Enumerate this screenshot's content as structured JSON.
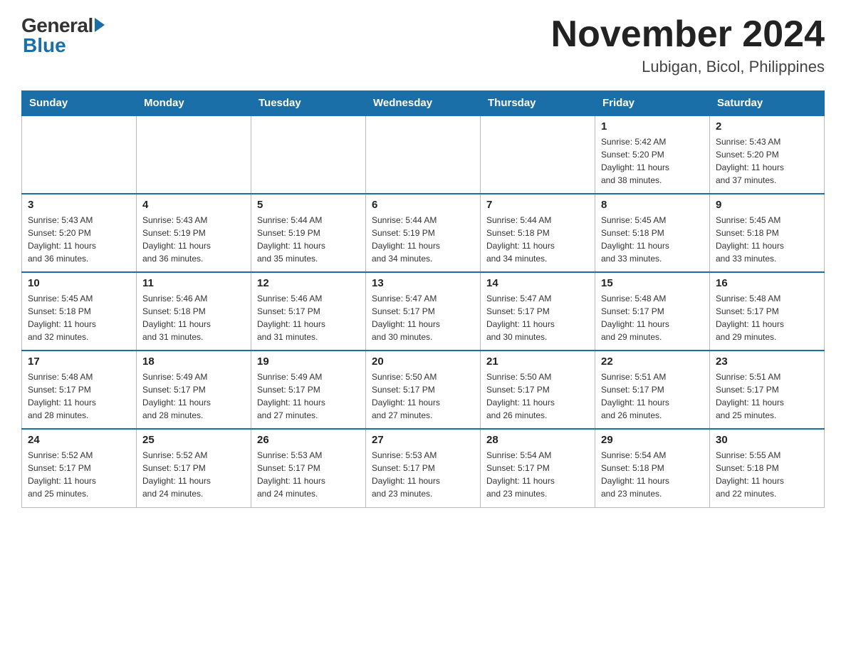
{
  "header": {
    "logo_general": "General",
    "logo_blue": "Blue",
    "month_year": "November 2024",
    "location": "Lubigan, Bicol, Philippines"
  },
  "weekdays": [
    "Sunday",
    "Monday",
    "Tuesday",
    "Wednesday",
    "Thursday",
    "Friday",
    "Saturday"
  ],
  "weeks": [
    [
      {
        "day": "",
        "info": ""
      },
      {
        "day": "",
        "info": ""
      },
      {
        "day": "",
        "info": ""
      },
      {
        "day": "",
        "info": ""
      },
      {
        "day": "",
        "info": ""
      },
      {
        "day": "1",
        "info": "Sunrise: 5:42 AM\nSunset: 5:20 PM\nDaylight: 11 hours\nand 38 minutes."
      },
      {
        "day": "2",
        "info": "Sunrise: 5:43 AM\nSunset: 5:20 PM\nDaylight: 11 hours\nand 37 minutes."
      }
    ],
    [
      {
        "day": "3",
        "info": "Sunrise: 5:43 AM\nSunset: 5:20 PM\nDaylight: 11 hours\nand 36 minutes."
      },
      {
        "day": "4",
        "info": "Sunrise: 5:43 AM\nSunset: 5:19 PM\nDaylight: 11 hours\nand 36 minutes."
      },
      {
        "day": "5",
        "info": "Sunrise: 5:44 AM\nSunset: 5:19 PM\nDaylight: 11 hours\nand 35 minutes."
      },
      {
        "day": "6",
        "info": "Sunrise: 5:44 AM\nSunset: 5:19 PM\nDaylight: 11 hours\nand 34 minutes."
      },
      {
        "day": "7",
        "info": "Sunrise: 5:44 AM\nSunset: 5:18 PM\nDaylight: 11 hours\nand 34 minutes."
      },
      {
        "day": "8",
        "info": "Sunrise: 5:45 AM\nSunset: 5:18 PM\nDaylight: 11 hours\nand 33 minutes."
      },
      {
        "day": "9",
        "info": "Sunrise: 5:45 AM\nSunset: 5:18 PM\nDaylight: 11 hours\nand 33 minutes."
      }
    ],
    [
      {
        "day": "10",
        "info": "Sunrise: 5:45 AM\nSunset: 5:18 PM\nDaylight: 11 hours\nand 32 minutes."
      },
      {
        "day": "11",
        "info": "Sunrise: 5:46 AM\nSunset: 5:18 PM\nDaylight: 11 hours\nand 31 minutes."
      },
      {
        "day": "12",
        "info": "Sunrise: 5:46 AM\nSunset: 5:17 PM\nDaylight: 11 hours\nand 31 minutes."
      },
      {
        "day": "13",
        "info": "Sunrise: 5:47 AM\nSunset: 5:17 PM\nDaylight: 11 hours\nand 30 minutes."
      },
      {
        "day": "14",
        "info": "Sunrise: 5:47 AM\nSunset: 5:17 PM\nDaylight: 11 hours\nand 30 minutes."
      },
      {
        "day": "15",
        "info": "Sunrise: 5:48 AM\nSunset: 5:17 PM\nDaylight: 11 hours\nand 29 minutes."
      },
      {
        "day": "16",
        "info": "Sunrise: 5:48 AM\nSunset: 5:17 PM\nDaylight: 11 hours\nand 29 minutes."
      }
    ],
    [
      {
        "day": "17",
        "info": "Sunrise: 5:48 AM\nSunset: 5:17 PM\nDaylight: 11 hours\nand 28 minutes."
      },
      {
        "day": "18",
        "info": "Sunrise: 5:49 AM\nSunset: 5:17 PM\nDaylight: 11 hours\nand 28 minutes."
      },
      {
        "day": "19",
        "info": "Sunrise: 5:49 AM\nSunset: 5:17 PM\nDaylight: 11 hours\nand 27 minutes."
      },
      {
        "day": "20",
        "info": "Sunrise: 5:50 AM\nSunset: 5:17 PM\nDaylight: 11 hours\nand 27 minutes."
      },
      {
        "day": "21",
        "info": "Sunrise: 5:50 AM\nSunset: 5:17 PM\nDaylight: 11 hours\nand 26 minutes."
      },
      {
        "day": "22",
        "info": "Sunrise: 5:51 AM\nSunset: 5:17 PM\nDaylight: 11 hours\nand 26 minutes."
      },
      {
        "day": "23",
        "info": "Sunrise: 5:51 AM\nSunset: 5:17 PM\nDaylight: 11 hours\nand 25 minutes."
      }
    ],
    [
      {
        "day": "24",
        "info": "Sunrise: 5:52 AM\nSunset: 5:17 PM\nDaylight: 11 hours\nand 25 minutes."
      },
      {
        "day": "25",
        "info": "Sunrise: 5:52 AM\nSunset: 5:17 PM\nDaylight: 11 hours\nand 24 minutes."
      },
      {
        "day": "26",
        "info": "Sunrise: 5:53 AM\nSunset: 5:17 PM\nDaylight: 11 hours\nand 24 minutes."
      },
      {
        "day": "27",
        "info": "Sunrise: 5:53 AM\nSunset: 5:17 PM\nDaylight: 11 hours\nand 23 minutes."
      },
      {
        "day": "28",
        "info": "Sunrise: 5:54 AM\nSunset: 5:17 PM\nDaylight: 11 hours\nand 23 minutes."
      },
      {
        "day": "29",
        "info": "Sunrise: 5:54 AM\nSunset: 5:18 PM\nDaylight: 11 hours\nand 23 minutes."
      },
      {
        "day": "30",
        "info": "Sunrise: 5:55 AM\nSunset: 5:18 PM\nDaylight: 11 hours\nand 22 minutes."
      }
    ]
  ]
}
